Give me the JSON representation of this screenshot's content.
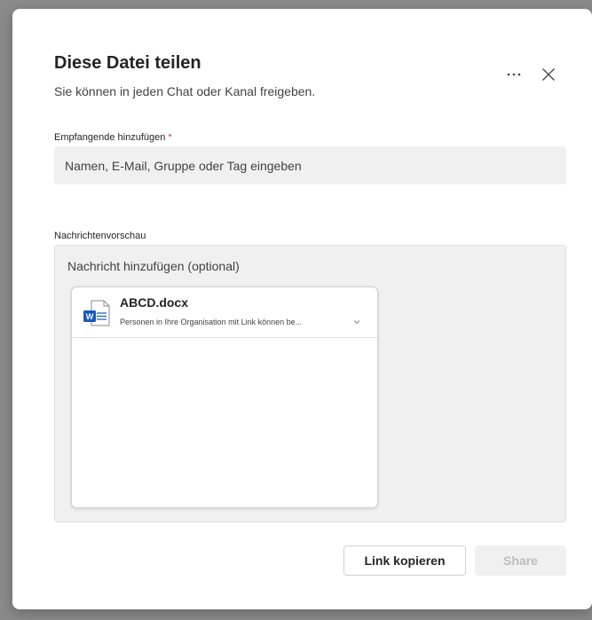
{
  "dialog": {
    "title": "Diese Datei teilen",
    "subtitle": "Sie können in jeden Chat oder Kanal freigeben.",
    "more_icon": "more-horizontal-icon",
    "close_icon": "close-icon"
  },
  "recipients": {
    "label": "Empfangende hinzufügen",
    "required_marker": "*",
    "placeholder": "Namen, E-Mail, Gruppe oder Tag eingeben"
  },
  "preview": {
    "label": "Nachrichtenvorschau",
    "message_placeholder": "Nachricht hinzufügen (optional)",
    "file": {
      "name": "ABCD.docx",
      "permission": "Personen in Ihre Organisation mit Link können be...",
      "icon": "word-document-icon",
      "icon_letter": "W"
    }
  },
  "actions": {
    "copy_link": "Link kopieren",
    "share": "Share"
  },
  "colors": {
    "overlay": "#8a8a8a",
    "field_bg": "#f0f0f0",
    "required": "#c4314b",
    "word_blue": "#185abd",
    "disabled_text": "#bdbdbd"
  }
}
